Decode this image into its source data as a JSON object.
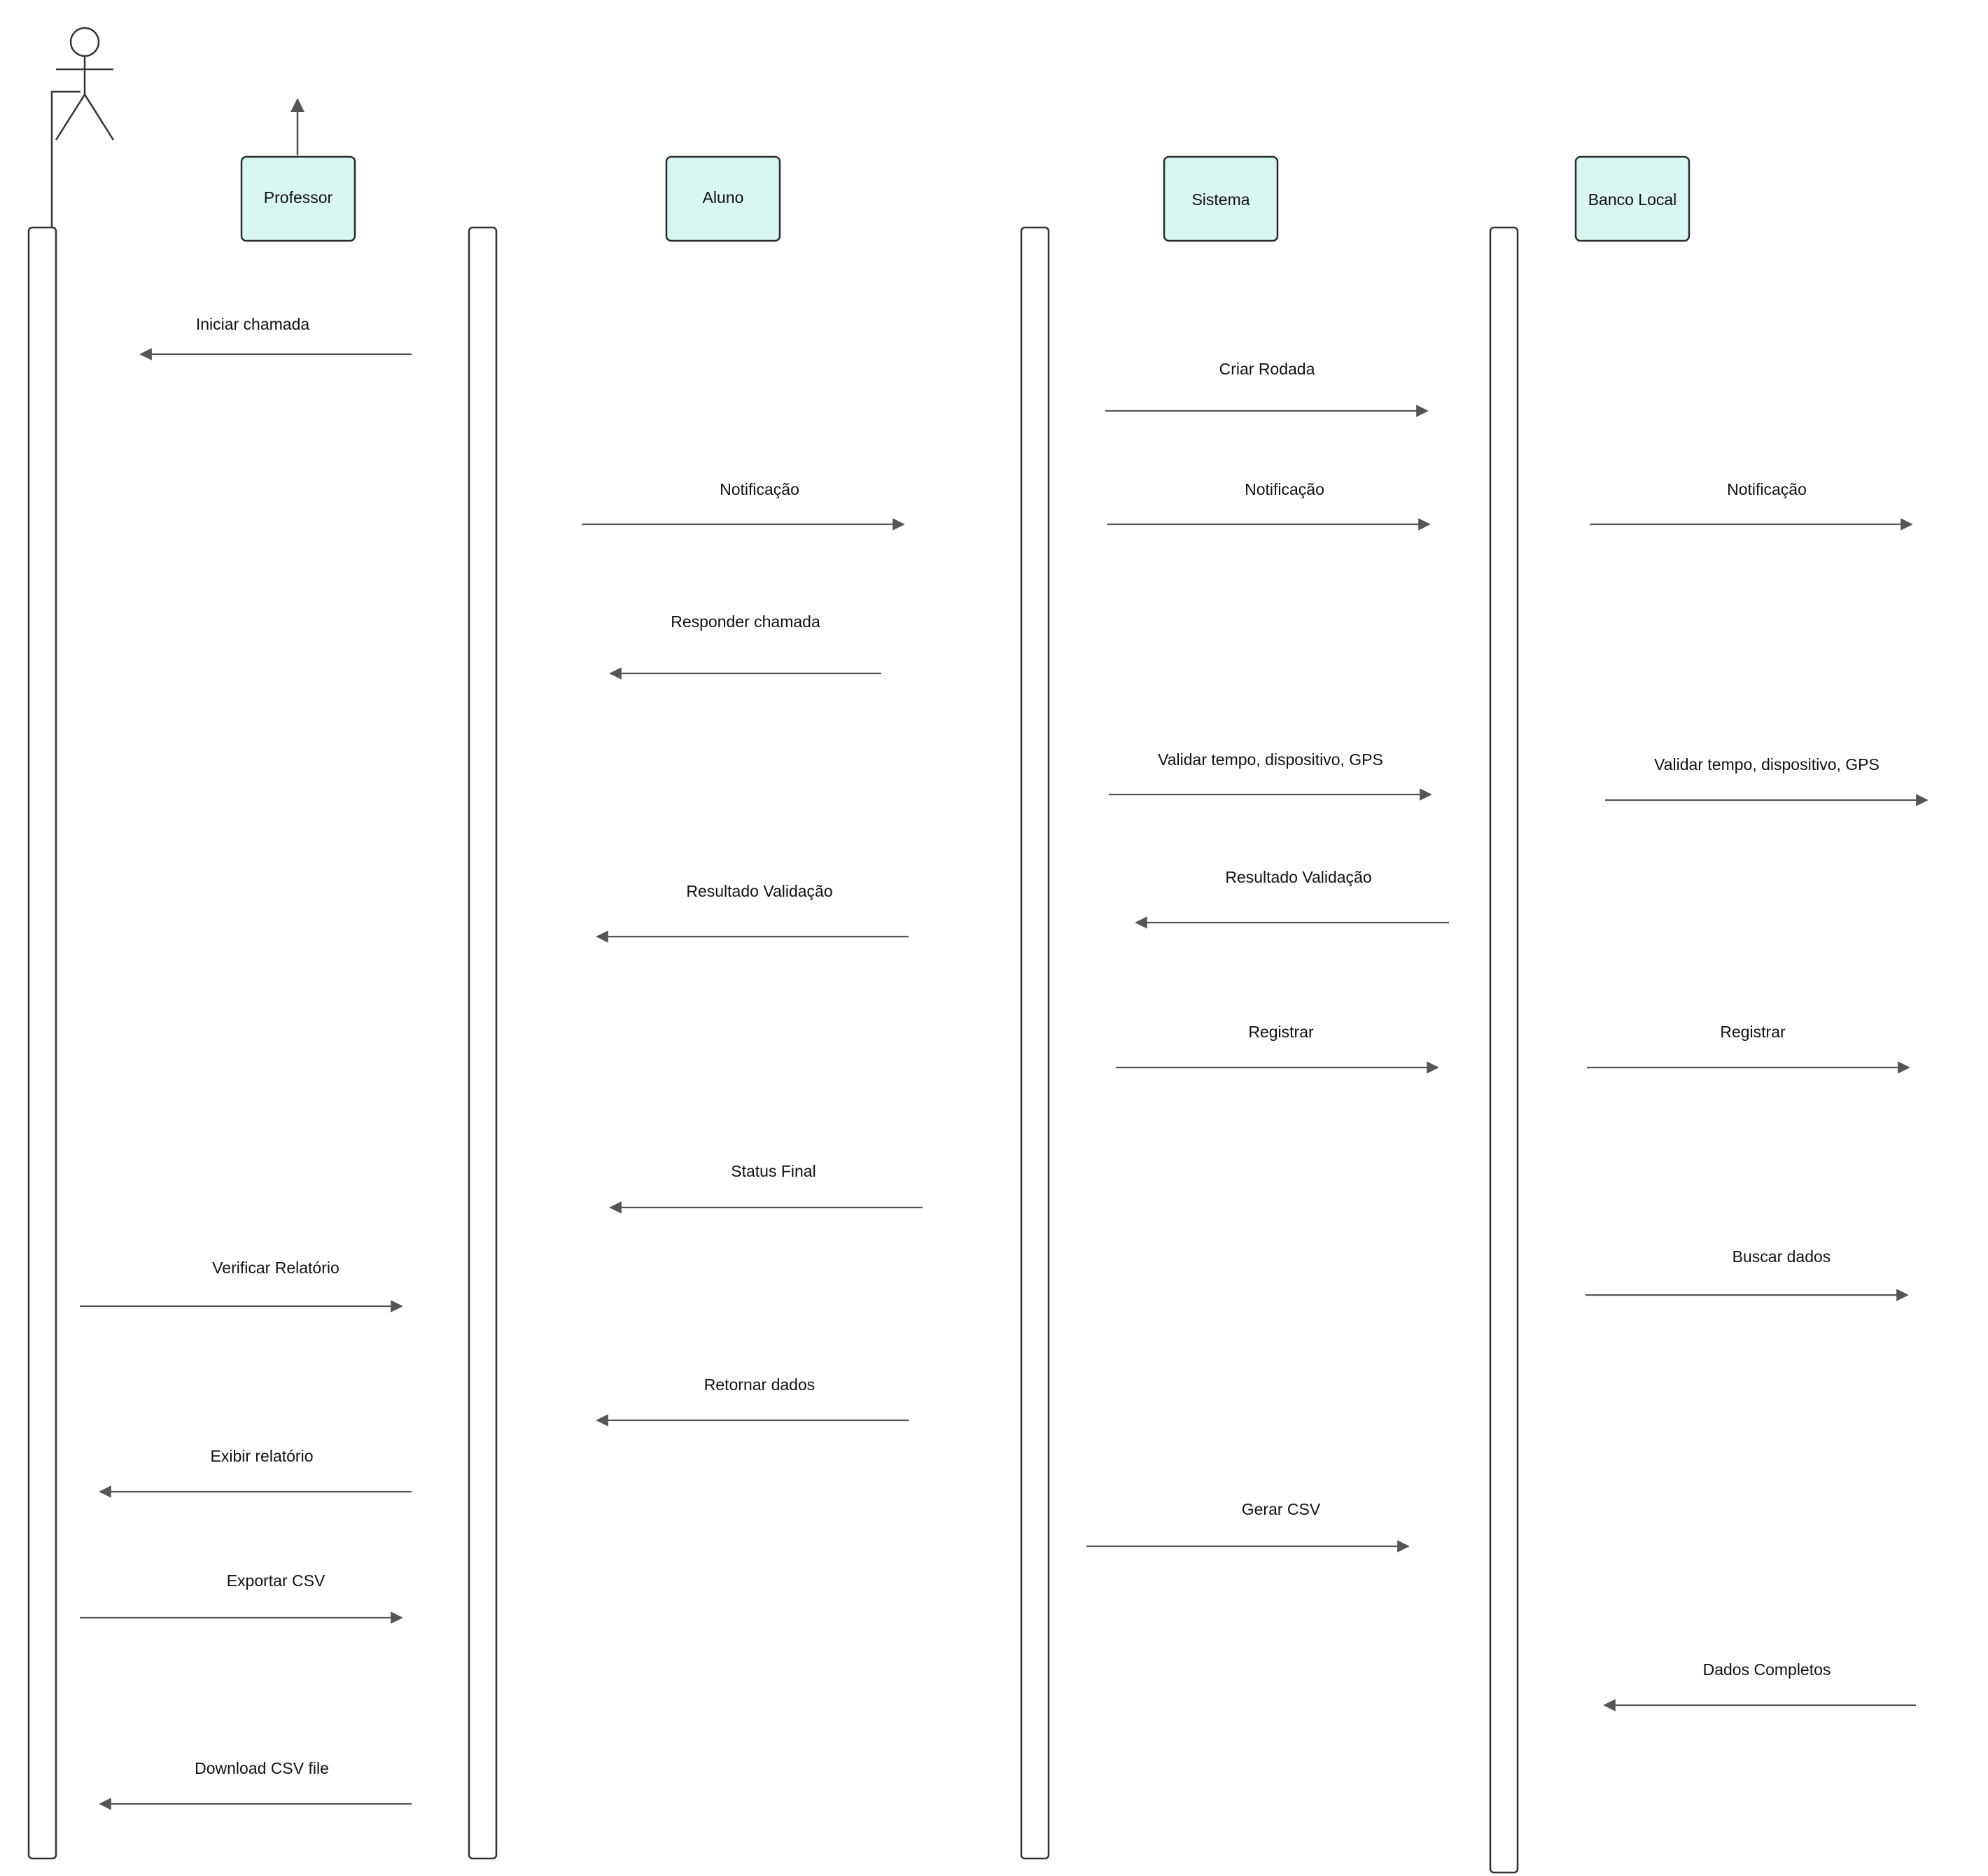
{
  "colors": {
    "participant_fill": "#d8f7f2",
    "participant_stroke": "#2b2b2b",
    "line": "#555555",
    "text": "#111111"
  },
  "participants": [
    {
      "id": "professor",
      "label": "Professor"
    },
    {
      "id": "aluno",
      "label": "Aluno"
    },
    {
      "id": "sistema",
      "label": "Sistema"
    },
    {
      "id": "banco",
      "label": "Banco Local"
    }
  ],
  "actor": {
    "icon": "stick-figure-actor-icon"
  },
  "messages": [
    {
      "label": "Iniciar chamada",
      "direction": "left"
    },
    {
      "label": "Criar Rodada",
      "direction": "right"
    },
    {
      "label": "Notificação",
      "direction": "right"
    },
    {
      "label": "Notificação",
      "direction": "right"
    },
    {
      "label": "Notificação",
      "direction": "right"
    },
    {
      "label": "Responder chamada",
      "direction": "left"
    },
    {
      "label": "Validar tempo, dispositivo, GPS",
      "direction": "right"
    },
    {
      "label": "Validar tempo, dispositivo, GPS",
      "direction": "right"
    },
    {
      "label": "Resultado Validação",
      "direction": "left"
    },
    {
      "label": "Resultado Validação",
      "direction": "left"
    },
    {
      "label": "Registrar",
      "direction": "right"
    },
    {
      "label": "Registrar",
      "direction": "right"
    },
    {
      "label": "Status Final",
      "direction": "left"
    },
    {
      "label": "Verificar Relatório",
      "direction": "right"
    },
    {
      "label": "Buscar dados",
      "direction": "right"
    },
    {
      "label": "Retornar dados",
      "direction": "left"
    },
    {
      "label": "Exibir relatório",
      "direction": "left"
    },
    {
      "label": "Gerar CSV",
      "direction": "right"
    },
    {
      "label": "Exportar CSV",
      "direction": "right"
    },
    {
      "label": "Dados Completos",
      "direction": "left"
    },
    {
      "label": "Download CSV file",
      "direction": "left"
    }
  ]
}
